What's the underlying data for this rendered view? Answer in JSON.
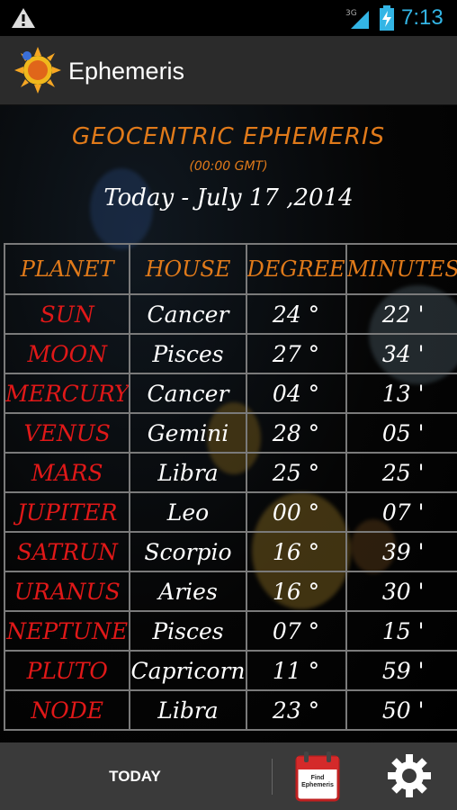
{
  "status_bar": {
    "time": "7:13",
    "network": "3G"
  },
  "app": {
    "title": "Ephemeris"
  },
  "header": {
    "title": "GEOCENTRIC EPHEMERIS",
    "subtitle": "(00:00 GMT)",
    "date": "Today - July 17 ,2014"
  },
  "table": {
    "columns": [
      "PLANET",
      "HOUSE",
      "DEGREE",
      "MINUTES"
    ],
    "rows": [
      {
        "planet": "SUN",
        "house": "Cancer",
        "degree": "24 °",
        "minutes": "22 '"
      },
      {
        "planet": "MOON",
        "house": "Pisces",
        "degree": "27 °",
        "minutes": "34 '"
      },
      {
        "planet": "MERCURY",
        "house": "Cancer",
        "degree": "04 °",
        "minutes": "13 '"
      },
      {
        "planet": "VENUS",
        "house": "Gemini",
        "degree": "28 °",
        "minutes": "05 '"
      },
      {
        "planet": "MARS",
        "house": "Libra",
        "degree": "25 °",
        "minutes": "25 '"
      },
      {
        "planet": "JUPITER",
        "house": "Leo",
        "degree": "00 °",
        "minutes": "07 '"
      },
      {
        "planet": "SATRUN",
        "house": "Scorpio",
        "degree": "16 °",
        "minutes": "39 '"
      },
      {
        "planet": "URANUS",
        "house": "Aries",
        "degree": "16 °",
        "minutes": "30 '"
      },
      {
        "planet": "NEPTUNE",
        "house": "Pisces",
        "degree": "07 °",
        "minutes": "15 '"
      },
      {
        "planet": "PLUTO",
        "house": "Capricorn",
        "degree": "11 °",
        "minutes": "59 '"
      },
      {
        "planet": "NODE",
        "house": "Libra",
        "degree": "23 °",
        "minutes": "50 '"
      }
    ]
  },
  "bottom_bar": {
    "today_label": "TODAY",
    "find_label": "Find Ephemeris"
  },
  "colors": {
    "accent_orange": "#e07a1a",
    "planet_red": "#e01818",
    "status_blue": "#33b5e5"
  },
  "icons": [
    "warning-icon",
    "signal-icon",
    "battery-icon",
    "app-sun-icon",
    "calendar-icon",
    "gear-icon"
  ]
}
